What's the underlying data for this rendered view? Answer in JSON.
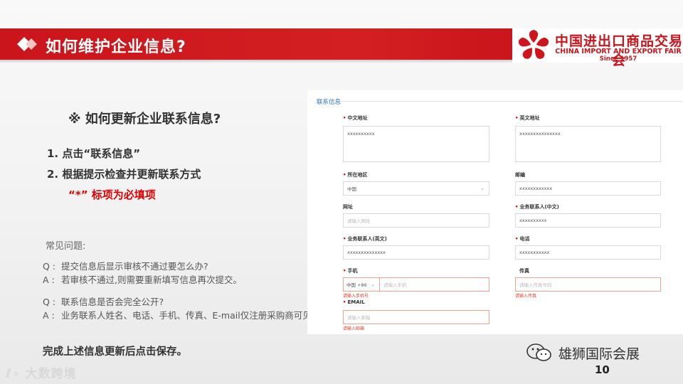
{
  "header": {
    "title": "如何维护企业信息?",
    "logo": {
      "cn_name": "中国进出口商品交易会",
      "en_name": "CHINA IMPORT AND EXPORT FAIR",
      "since": "Since 1957"
    }
  },
  "content": {
    "subtitle": "※ 如何更新企业联系信息?",
    "steps": [
      "1.  点击“联系信息”",
      "2.  根据提示检查并更新联系方式"
    ],
    "required_note": "“*”  标项为必填项",
    "faq_title": "常见问题:",
    "faq": [
      {
        "q_label": "Q :",
        "q": "提交信息后显示审核不通过要怎么办?",
        "a_label": "A :",
        "a": "若审核不通过,则需要重新填写信息再次提交。"
      },
      {
        "q_label": "Q :",
        "q": "联系信息是否会完全公开?",
        "a_label": "A :",
        "a": "业务联系人姓名、电话、手机、传真、E-mail仅注册采购商可见。"
      }
    ],
    "final_note": "完成上述信息更新后点击保存。"
  },
  "form": {
    "section_title": "联系信息",
    "cn_address": {
      "label": "中文地址",
      "required": true,
      "value": "xxxxxxxxxx"
    },
    "en_address": {
      "label": "英文地址",
      "required": true,
      "value": "xxxxxxxxxxxxxxx"
    },
    "region": {
      "label": "所在地区",
      "required": true,
      "value": "中国"
    },
    "postcode": {
      "label": "邮编",
      "required": false,
      "value": "xxxxxxxxxxxx"
    },
    "website": {
      "label": "网址",
      "required": false,
      "placeholder": "请输入网址"
    },
    "contact_cn": {
      "label": "业务联系人(中文)",
      "required": true,
      "value": "xxxxxxxxxx"
    },
    "contact_en": {
      "label": "业务联系人(英文)",
      "required": true,
      "value": "xxxxxxxxxxxxxx"
    },
    "phone": {
      "label": "电话",
      "required": true,
      "value": "xxxxxxxxxxx"
    },
    "mobile": {
      "label": "手机",
      "required": true,
      "prefix": "中国 +86",
      "placeholder": "请输入手机",
      "error": "请输入手机号"
    },
    "fax": {
      "label": "传真",
      "required": false,
      "placeholder": "请输入传真号码",
      "error": "请输入传真"
    },
    "email": {
      "label": "EMAIL",
      "required": true,
      "placeholder": "请输入邮箱",
      "error": "请输入邮箱"
    }
  },
  "footer": {
    "watermark_left": "大数跨境",
    "watermark_right": "雄狮国际会展",
    "page_number": "10"
  },
  "colors": {
    "brand_red": "#c9151b",
    "link_blue": "#2c72c7",
    "required_red": "#e00000"
  }
}
